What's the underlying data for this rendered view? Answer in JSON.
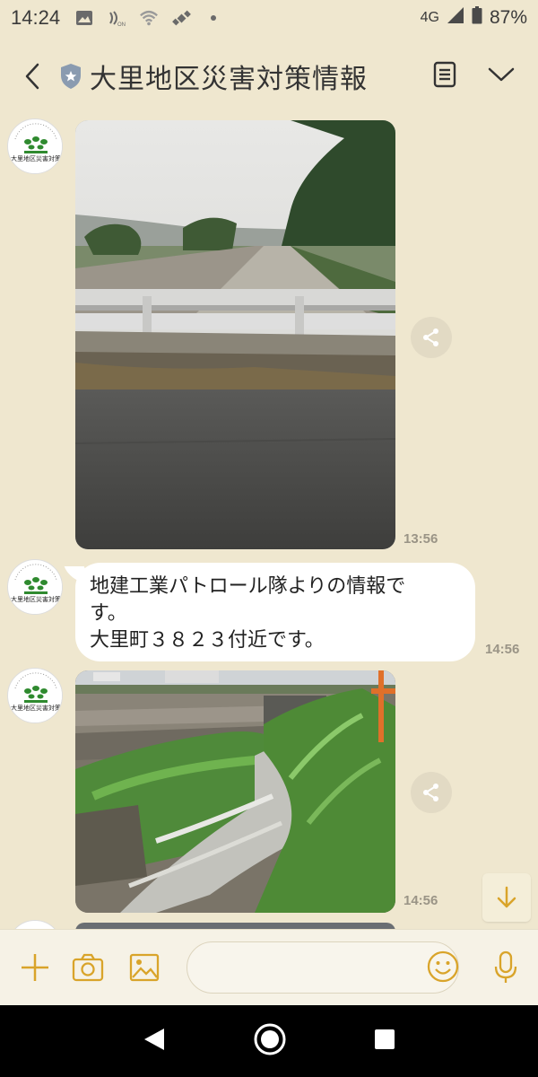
{
  "status_bar": {
    "time": "14:24",
    "network": "4G",
    "battery_percent": "87%"
  },
  "header": {
    "title": "大里地区災害対策情報"
  },
  "messages": [
    {
      "type": "image",
      "timestamp": "13:56"
    },
    {
      "type": "text",
      "lines": [
        "地建工業パトロール隊よりの情報で",
        "す。",
        "大里町３８２３付近です。"
      ],
      "timestamp": "14:56"
    },
    {
      "type": "image",
      "timestamp": "14:56"
    }
  ],
  "input": {
    "placeholder": ""
  },
  "colors": {
    "background": "#efe7cf",
    "accent_icon": "#d9a42a",
    "bubble": "#ffffff"
  },
  "icons": {
    "header": [
      "back-icon",
      "shield-icon",
      "notes-icon",
      "chevron-down-icon"
    ],
    "input_bar": [
      "plus-icon",
      "camera-icon",
      "image-icon",
      "emoji-icon",
      "mic-icon"
    ],
    "nav": [
      "nav-back-icon",
      "nav-home-icon",
      "nav-recents-icon"
    ]
  }
}
